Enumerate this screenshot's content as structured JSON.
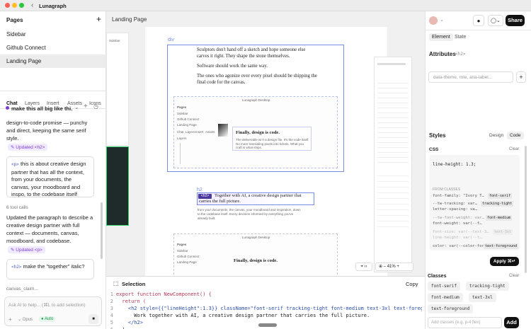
{
  "app": {
    "title": "Lunagraph"
  },
  "pages": {
    "title": "Pages",
    "items": [
      "Sidebar",
      "Github Connect",
      "Landing Page"
    ]
  },
  "left_tabs": [
    "Chat",
    "Layers",
    "Insert",
    "Assets",
    "Icons"
  ],
  "chat": {
    "thread": "make this all big like thi...",
    "msg1": "design-to-code promise — punchy and direct, keeping the same serif style.",
    "badge1": "Updated <h2>",
    "card1_tag": "<p>",
    "card1_text": "this is about creative design partner that has all the context, from your documents, the canvas, your moodboard and inspo, to the codebase itself",
    "tool_calls": "6 tool calls",
    "msg2": "Updated the paragraph to describe a creative design partner with full context — documents, canvas, moodboard, and codebase.",
    "badge2": "Updated <p>",
    "card2_tag": "<h2>",
    "card2_text": "make the \"together\" italic?",
    "more": "canvas_claim...",
    "placeholder": "Ask AI to help... (⌘L to add selection)",
    "opus": "Opus",
    "auto": "Auto"
  },
  "canvas": {
    "page_label": "Landing Page",
    "div_label": "div",
    "h2_label": "h2",
    "para1": "Sculptors don't hand off a sketch and hope someone else carves it right. They shape the stone themselves.",
    "para2": "Software should work the same way.",
    "para3": "The ones who agonize over every pixel should be shipping the final code for the canvas.",
    "mini_title": "Lunagraph Desktop",
    "mini_pages": "Pages",
    "mini_items": [
      "Sidebar",
      "Github Connect",
      "Landing Page"
    ],
    "mini_tabs": [
      "Chat",
      "Layers",
      "Insert",
      "Assets",
      "Icons"
    ],
    "mini_layers": "Layers",
    "card_heading": "Finally, design is code.",
    "card_body": "The deliverable isn't a design file. It's the code itself. No more translating pixels into tickets. What you craft is what ships.",
    "h2_text": "Together with AI, a creative design partner that carries the full picture.",
    "sub_p": "from your documents, the canvas, your moodboard and inspiration, down to the codebase itself. Every decision informed by everything you've already built.",
    "zoom": "41%"
  },
  "code_panel": {
    "title": "Selection",
    "copy": "Copy",
    "lines": [
      "export function NewComponent() {",
      "  return (",
      "    <h2 style={{\"lineHeight\":1.3}} className=\"font-serif tracking-tight font-medium text-3xl text-foregrou",
      "      Work together with AI, a creative design partner that carries the full picture.",
      "    </h2>",
      "  )"
    ]
  },
  "right": {
    "share": "Share",
    "tabs": [
      "Element",
      "State"
    ],
    "attributes_title": "Attributes",
    "attributes_tag": "<h2>",
    "attr_placeholder": "data-theme, role, aria-label...",
    "styles_title": "Styles",
    "styles_tabs": [
      "Design",
      "Code"
    ],
    "css_label": "CSS",
    "clear": "Clear",
    "css_line": "line-height: 1.3;",
    "from_classes": "FROM CLASSES",
    "class_rows": [
      {
        "prop": "font-family: \"Ivory T…",
        "tag": "font-serif"
      },
      {
        "prop": "--tw-tracking: var…",
        "tag": "tracking-tight"
      },
      {
        "prop": "letter-spacing: va…",
        "tag": ""
      },
      {
        "prop": "--tw-font-weight: var…",
        "tag": "font-medium"
      },
      {
        "prop": "font-weight: var(--f…",
        "tag": ""
      },
      {
        "prop": "font-size: var(--text-3…",
        "tag": "text-3xl"
      },
      {
        "prop": "line-height: var(--t…",
        "tag": ""
      },
      {
        "prop": "color: var(--color-fore…",
        "tag": "text-foreground"
      }
    ],
    "apply": "Apply ⌘↵",
    "classes_title": "Classes",
    "classes": [
      "font-serif",
      "tracking-tight",
      "font-medium",
      "text-3xl",
      "text-foreground"
    ],
    "add_placeholder": "Add classes (e.g. p-4 flex)",
    "add": "Add"
  },
  "colors": {
    "accent": "#7b8ce8",
    "purple": "#7a3fd0",
    "dark": "#111111"
  }
}
